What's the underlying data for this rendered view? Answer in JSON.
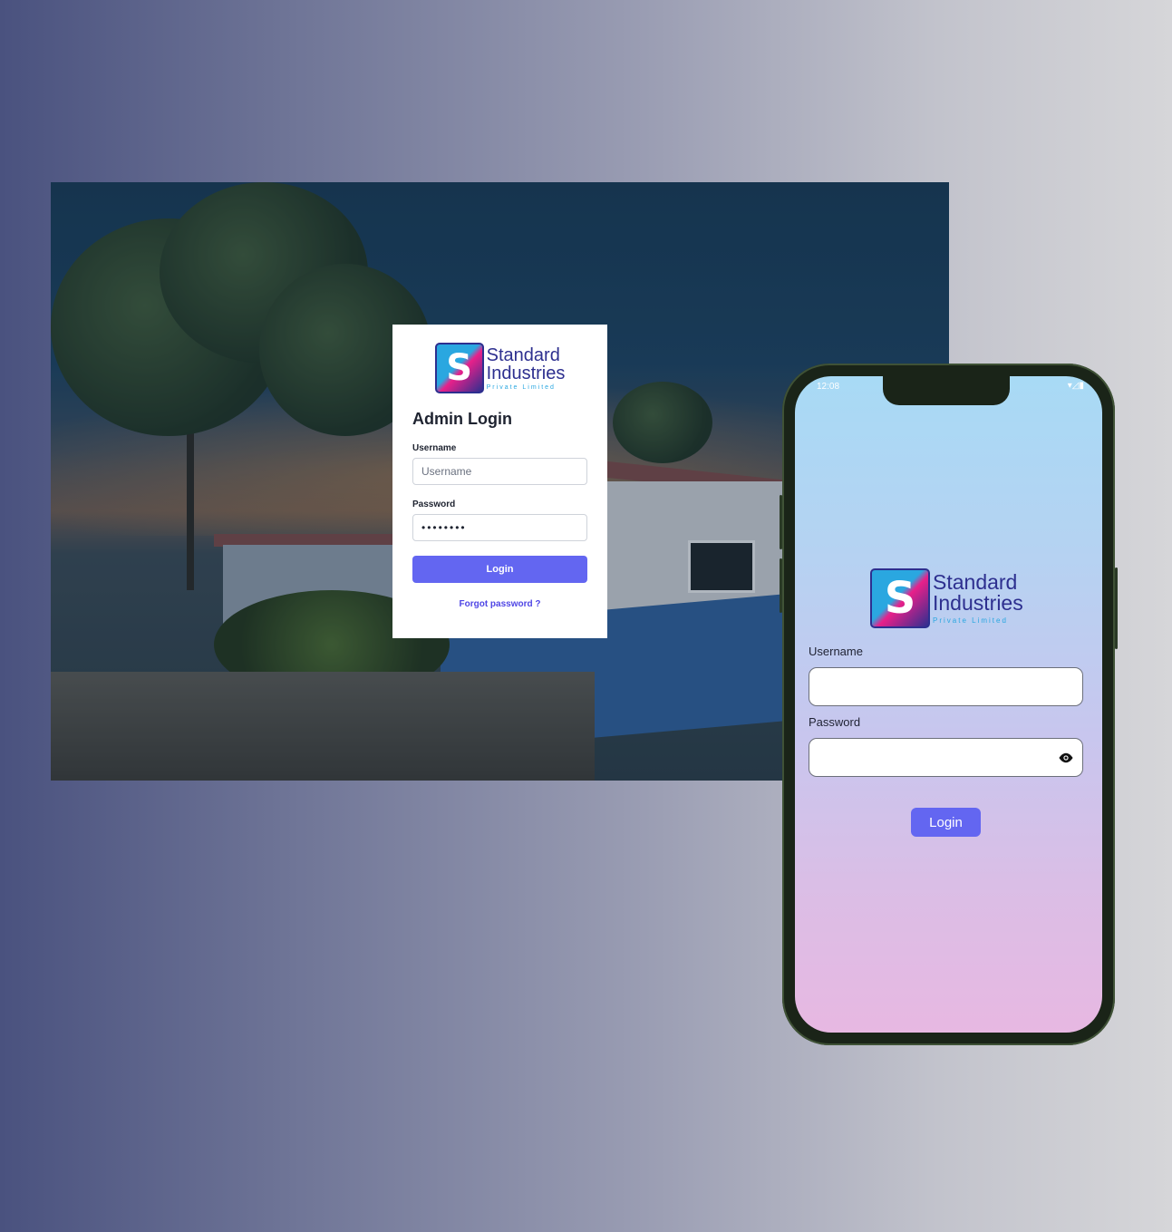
{
  "brand": {
    "name_line1": "Standard",
    "name_line2": "Industries",
    "name_line3": "Private Limited",
    "logo_letter": "S",
    "colors": {
      "navy": "#2d2f8f",
      "cyan": "#2aa7e0",
      "magenta": "#e8208a"
    }
  },
  "web_login": {
    "title": "Admin Login",
    "username_label": "Username",
    "username_placeholder": "Username",
    "password_label": "Password",
    "password_value": "••••••••",
    "login_button": "Login",
    "forgot_link": "Forgot password ?",
    "accent": "#6366f1"
  },
  "mobile_login": {
    "status_time": "12:08",
    "status_icons": "▾◿▮",
    "username_label": "Username",
    "username_value": "",
    "password_label": "Password",
    "password_value": "",
    "password_toggle_icon": "eye-icon",
    "login_button": "Login",
    "accent": "#6366f1"
  }
}
